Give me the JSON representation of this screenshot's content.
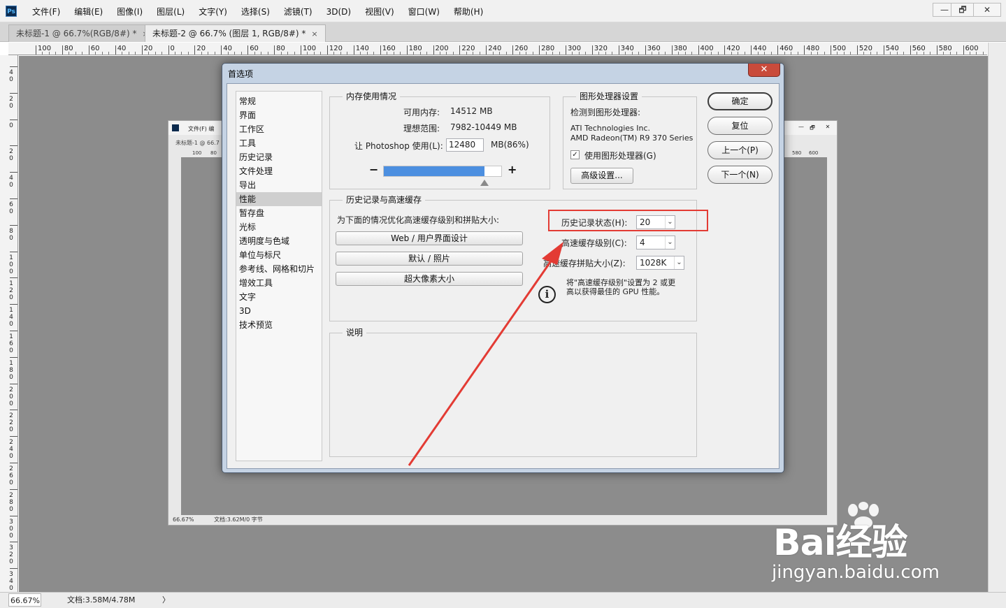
{
  "app": {
    "logo": "Ps"
  },
  "menu": [
    "文件(F)",
    "编辑(E)",
    "图像(I)",
    "图层(L)",
    "文字(Y)",
    "选择(S)",
    "滤镜(T)",
    "3D(D)",
    "视图(V)",
    "窗口(W)",
    "帮助(H)"
  ],
  "window_controls": {
    "minimize": "—",
    "restore": "🗗",
    "close": "✕"
  },
  "tabs": [
    {
      "label": "未标题-1 @ 66.7%(RGB/8#) *",
      "close": "×"
    },
    {
      "label": "未标题-2 @ 66.7% (图层 1, RGB/8#) *",
      "close": "×"
    }
  ],
  "ruler": {
    "h_labels": [
      "100",
      "80",
      "60",
      "40",
      "20",
      "0",
      "20",
      "40",
      "60",
      "80",
      "100",
      "120",
      "140",
      "160",
      "180",
      "200",
      "220",
      "240",
      "260",
      "280",
      "300",
      "320",
      "340",
      "360",
      "380",
      "400",
      "420",
      "440",
      "460",
      "480",
      "500",
      "520",
      "540",
      "560",
      "580",
      "600"
    ],
    "v_labels": [
      "40",
      "20",
      "0",
      "20",
      "40",
      "60",
      "80",
      "100",
      "120",
      "140",
      "160",
      "180",
      "200",
      "220",
      "240",
      "260",
      "280",
      "300",
      "320",
      "340"
    ]
  },
  "nested_window": {
    "menu_text": "文件(F)  编",
    "tab": "未标题-1 @ 66.7",
    "status": "66.67%",
    "doc": "文档:3.62M/0 字节",
    "controls": [
      "—",
      "🗗",
      "✕"
    ],
    "ruler_left": [
      "100",
      "80"
    ],
    "ruler_right": [
      "580",
      "600"
    ]
  },
  "statusbar": {
    "zoom": "66.67%",
    "doc": "文档:3.58M/4.78M",
    "arrow": "〉"
  },
  "dialog": {
    "title": "首选项",
    "close": "✕",
    "categories": [
      "常规",
      "界面",
      "工作区",
      "工具",
      "历史记录",
      "文件处理",
      "导出",
      "性能",
      "暂存盘",
      "光标",
      "透明度与色域",
      "单位与标尺",
      "参考线、网格和切片",
      "增效工具",
      "文字",
      "3D",
      "技术预览"
    ],
    "selected_index": 7,
    "memory": {
      "title": "内存使用情况",
      "available_label": "可用内存:",
      "available_value": "14512 MB",
      "ideal_label": "理想范围:",
      "ideal_value": "7982-10449 MB",
      "let_label": "让 Photoshop 使用(L):",
      "let_value": "12480",
      "let_unit": "MB(86%)",
      "minus": "−",
      "plus": "+",
      "slider_fraction": 0.86
    },
    "gpu": {
      "title": "图形处理器设置",
      "detected_label": "检测到图形处理器:",
      "vendor": "ATI Technologies Inc.",
      "model": "AMD Radeon(TM) R9 370 Series",
      "use_gpu_label": "使用图形处理器(G)",
      "use_gpu_checked": "✓",
      "advanced_button": "高级设置..."
    },
    "history_cache": {
      "title": "历史记录与高速缓存",
      "optimize_text": "为下面的情况优化高速缓存级别和拼贴大小:",
      "presets": [
        "Web / 用户界面设计",
        "默认 / 照片",
        "超大像素大小"
      ],
      "history_states_label": "历史记录状态(H):",
      "history_states_value": "20",
      "cache_levels_label": "高速缓存级别(C):",
      "cache_levels_value": "4",
      "tile_size_label": "高速缓存拼贴大小(Z):",
      "tile_size_value": "1028K",
      "hint_line1": "将\"高速缓存级别\"设置为 2 或更",
      "hint_line2": "高以获得最佳的 GPU 性能。",
      "info_icon": "i"
    },
    "description": {
      "title": "说明"
    },
    "buttons": {
      "ok": "确定",
      "reset": "复位",
      "prev": "上一个(P)",
      "next": "下一个(N)"
    },
    "combo_arrow": "⌄"
  },
  "annotation": {
    "color": "#e33b34"
  },
  "watermark": {
    "brand": "Bai经验",
    "url": "jingyan.baidu.com"
  }
}
